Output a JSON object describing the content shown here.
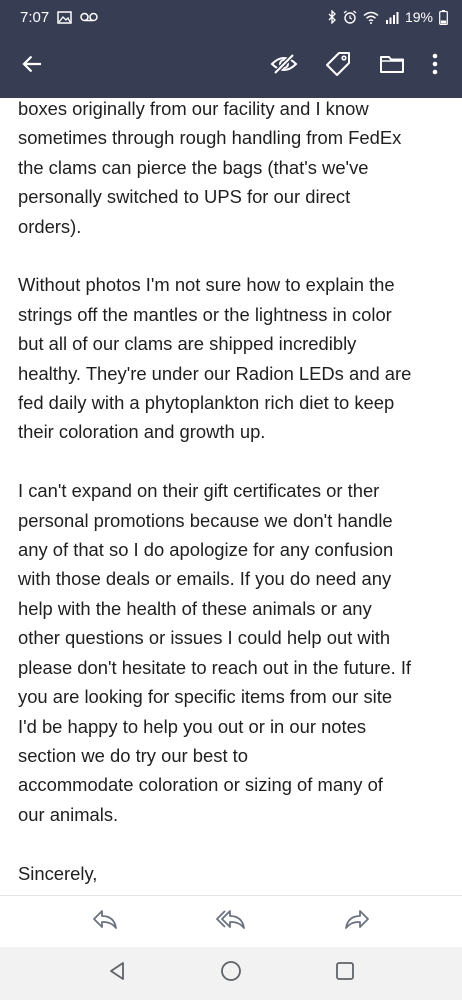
{
  "status_bar": {
    "time": "7:07",
    "battery": "19%"
  },
  "app_bar": {
    "icons": [
      "back-arrow-icon",
      "eye-off-icon",
      "tag-icon",
      "folder-icon",
      "more-vert-icon"
    ]
  },
  "email": {
    "paragraphs": [
      "boxes originally from our facility and I know\nsometimes through rough handling from FedEx\nthe clams can pierce the bags (that's we've\npersonally switched to UPS for our direct\norders).",
      "Without photos I'm not sure how to explain the\nstrings off the mantles or the lightness in color\nbut all of our clams are shipped incredibly\nhealthy. They're under our Radion LEDs and are\nfed daily with a phytoplankton rich diet to keep\ntheir coloration and growth up.",
      "I can't expand on their gift certificates or ther\npersonal promotions because we don't handle\nany of that so I do apologize for any confusion\nwith those deals or emails. If you do need any\nhelp with the health of these animals or any\nother questions or issues I could help out with\nplease don't hesitate to reach out in the future. If\nyou are looking for specific items from our site\nI'd be happy to help you out or in our notes\nsection we do try our best to\naccommodate coloration or sizing of many of\nour animals.",
      "Sincerely,"
    ]
  },
  "reply_bar": {
    "icons": [
      "reply-icon",
      "reply-all-icon",
      "forward-icon"
    ]
  },
  "nav_bar": {
    "icons": [
      "nav-back-icon",
      "nav-home-icon",
      "nav-recents-icon"
    ]
  },
  "colors": {
    "header_bg": "#373d52",
    "text": "#1f1f1f",
    "icon_gray": "#6b7280",
    "nav_bg": "#f2f2f2"
  }
}
